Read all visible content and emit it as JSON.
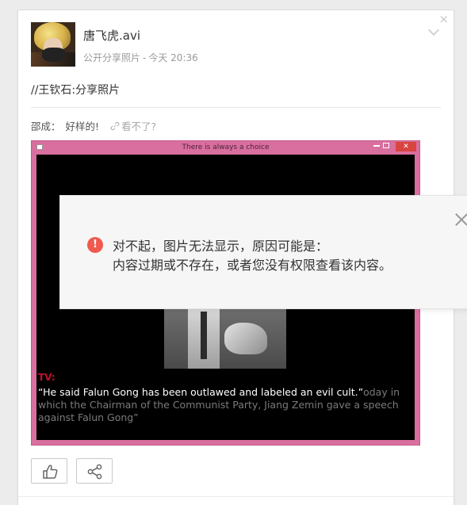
{
  "post": {
    "author": "唐飞虎.avi",
    "meta_action": "公开分享照片",
    "meta_separator": "-",
    "meta_time": "今天 20:36",
    "text": "//王钦石:分享照片"
  },
  "comment": {
    "name": "邵成：",
    "text": "好样的!",
    "link_label": "看不了?"
  },
  "embedded_image": {
    "window_title": "There is always a choice",
    "close_glyph": "✕",
    "tv_label": "TV:",
    "caption_white": "“He said Falun Gong has been outlawed and labeled an evil cult.”",
    "caption_gray": "oday in which the Chairman of the Communist Party, Jiang Zemin gave a speech against Falun Gong”"
  },
  "error": {
    "icon": "!",
    "line1": "对不起，图片无法显示，原因可能是：",
    "line2": "内容过期或不存在，或者您没有权限查看该内容。"
  },
  "card_close_glyph": "×",
  "icons": {
    "like": "thumbs-up-icon",
    "share": "share-icon",
    "link": "link-icon"
  },
  "colors": {
    "accent_error": "#f05a4e",
    "window_frame": "#d96f9e",
    "tv_red": "#c0122a"
  }
}
